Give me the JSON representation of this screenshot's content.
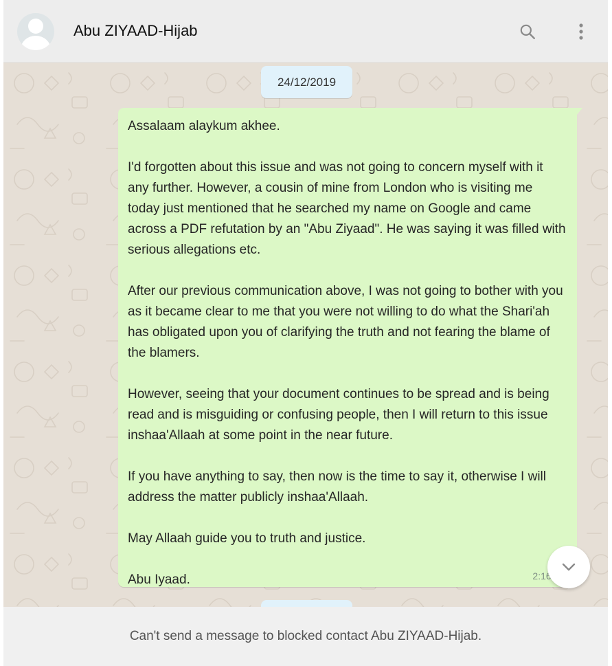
{
  "header": {
    "contact_name": "Abu ZIYAAD-Hijab",
    "icons": [
      "search-icon",
      "more-vertical-icon"
    ]
  },
  "chat": {
    "date_label": "24/12/2019",
    "message": {
      "paragraphs": [
        "Assalaam alaykum akhee.",
        "I'd forgotten about this issue and was not going to concern myself with it any further. However, a cousin of mine from London who is visiting me today just mentioned that he searched my name on Google and came across a PDF refutation by an \"Abu Ziyaad\". He was saying it was filled with serious allegations etc.",
        "After our previous communication above, I was not going to bother with you as it became clear to me that you were not willing to do what the Shari'ah has obligated upon you of clarifying the truth and not fearing the blame of the blamers.",
        "However, seeing that your document continues to be spread and is being read and is misguiding or confusing people, then I will return to this issue inshaa'Allaah at some point in the near future.",
        "If you have anything to say, then now is the time to say it, otherwise I will address the matter publicly inshaa'Allaah.",
        "May Allaah guide you to truth and justice.",
        "Abu Iyaad."
      ],
      "time": "2:16 pm"
    },
    "scroll_icon": "chevron-down-icon"
  },
  "footer": {
    "blocked_notice": "Can't send a message to blocked contact Abu ZIYAAD-Hijab."
  },
  "colors": {
    "header_bg": "#ededed",
    "chat_bg": "#e6dfd6",
    "outgoing_bubble": "#dcf8c6",
    "date_chip": "#e1f2fb",
    "footer_bg": "#f0f0f0"
  }
}
